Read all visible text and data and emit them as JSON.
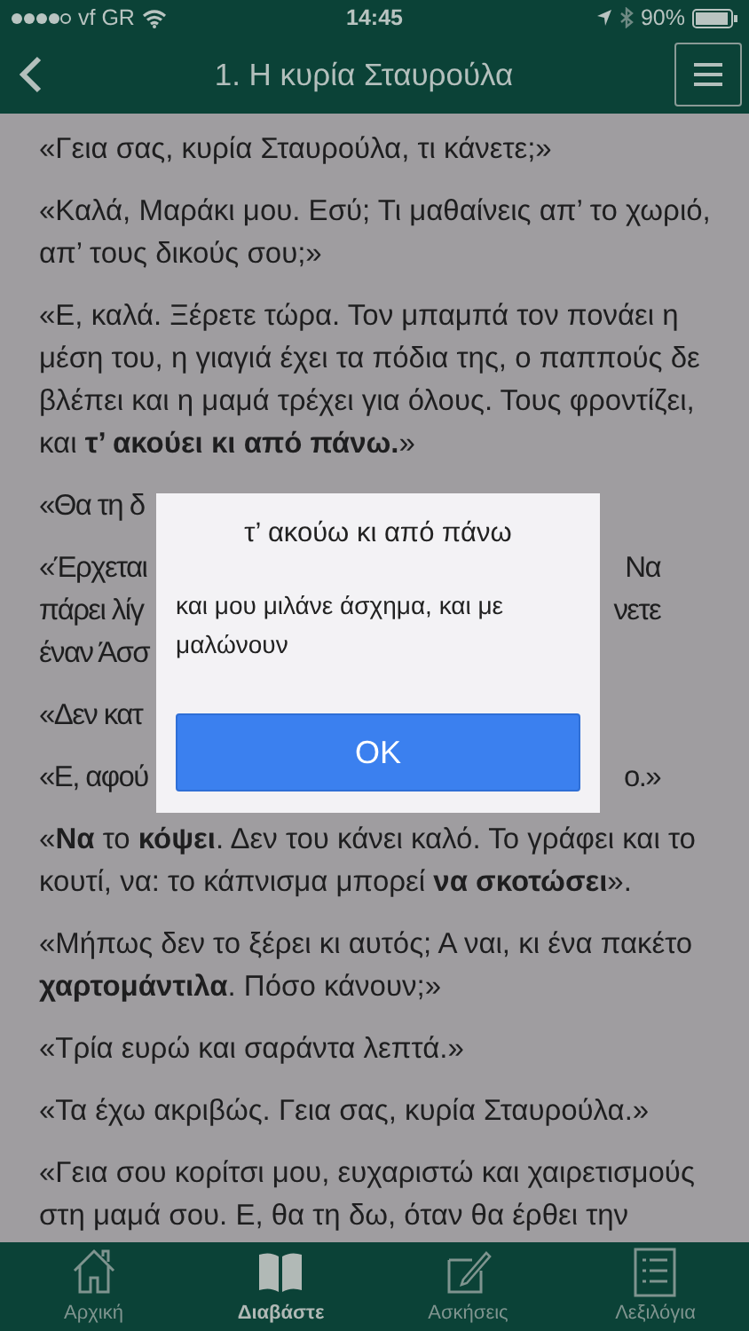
{
  "status_bar": {
    "carrier": "vf GR",
    "time": "14:45",
    "battery": "90%"
  },
  "header": {
    "title": "1. Η κυρία Σταυρούλα"
  },
  "paragraphs": [
    {
      "kind": "text",
      "lines": [
        "«Γεια σας, κυρία Σταυρούλα, τι κάνετε;»"
      ]
    },
    {
      "kind": "text",
      "lines": [
        "«Καλά, Μαράκι μου. Εσύ; Τι μαθαίνεις απ’ το χωριό,",
        "απ’ τους δικούς σου;»"
      ]
    },
    {
      "kind": "text",
      "lines": [
        "«Ε, καλά. Ξέρετε τώρα. Τον μπαμπά τον πονάει η",
        "μέση του, η γιαγιά έχει τα πόδια της, ο παππούς δε",
        "βλέπει και η μαμά τρέχει για όλους. Τους φροντίζει,",
        "και **τ’ ακούει κι από πάνω.**»"
      ]
    },
    {
      "kind": "covered",
      "lines": [
        {
          "left": "«Θα τη δ"
        }
      ]
    },
    {
      "kind": "covered",
      "lines": [
        {
          "left": "«Έρχεται",
          "right": "Να"
        },
        {
          "left": "πάρει λίγ",
          "right": "νετε"
        },
        {
          "left": "έναν Άσσ"
        }
      ]
    },
    {
      "kind": "covered",
      "lines": [
        {
          "left": "«Δεν κατ"
        }
      ]
    },
    {
      "kind": "covered",
      "lines": [
        {
          "left": "«Ε, αφού",
          "right": "ο.»"
        }
      ]
    },
    {
      "kind": "text",
      "lines": [
        "«**Να** το **κόψει**. Δεν του κάνει καλό. Το γράφει και το",
        "κουτί, να: το κάπνισμα μπορεί **να σκοτώσει**»."
      ]
    },
    {
      "kind": "text",
      "lines": [
        "«Μήπως δεν το ξέρει κι αυτός; Α ναι, κι ένα πακέτο",
        "**χαρτομάντιλα**. Πόσο κάνουν;»"
      ]
    },
    {
      "kind": "text",
      "lines": [
        "«Τρία ευρώ και σαράντα λεπτά.»"
      ]
    },
    {
      "kind": "text",
      "lines": [
        "«Τα έχω ακριβώς. Γεια σας, κυρία Σταυρούλα.»"
      ]
    },
    {
      "kind": "text",
      "lines": [
        "«Γεια σου κορίτσι μου, ευχαριστώ και χαιρετισμούς",
        "στη μαμά σου. Ε, θα τη δω, όταν θα έρθει την"
      ]
    }
  ],
  "dialog": {
    "title": "τ’ ακούω κι από πάνω",
    "message": "και μου μιλάνε άσχημα, και με μαλώνουν",
    "button": "OK"
  },
  "tabs": [
    {
      "kind": "home",
      "label": "Αρχική",
      "selected": false
    },
    {
      "kind": "book",
      "label": "Διαβάστε",
      "selected": true
    },
    {
      "kind": "edit",
      "label": "Ασκήσεις",
      "selected": false
    },
    {
      "kind": "list",
      "label": "Λεξιλόγια",
      "selected": false
    }
  ]
}
